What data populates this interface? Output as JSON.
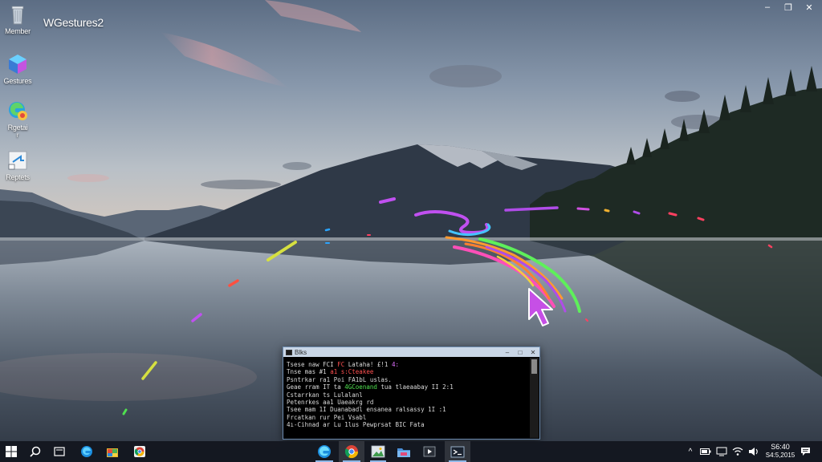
{
  "desktop": {
    "app_title": "WGestures2",
    "icons": [
      {
        "label": "Member",
        "sub": "",
        "icon": "recycle-bin-icon"
      },
      {
        "label": "Gestures",
        "sub": "",
        "icon": "cube-app-icon"
      },
      {
        "label": "Rgetai",
        "sub": "r",
        "icon": "edge-browser-icon"
      },
      {
        "label": "Reptets",
        "sub": "",
        "icon": "file-shortcut-icon"
      }
    ]
  },
  "window_controls": {
    "minimize": "–",
    "restore": "❐",
    "close": "✕"
  },
  "console": {
    "title": "Blks",
    "minimize": "–",
    "maximize": "□",
    "close": "✕",
    "lines": [
      {
        "a": "Tsese naw FCI ",
        "b": "FC",
        "c": " Lataha!  ",
        "d": "£!1  ",
        "e": "4:",
        "f": ""
      },
      {
        "a": "Tnse mas #1 ",
        "b": "",
        "c": "a1 s:Cteakee",
        "d": "",
        "e": "",
        "f": ""
      },
      {
        "a": "Psntrkar ra1 Poi FA1bL uslas.",
        "b": "",
        "c": "",
        "d": "",
        "e": "",
        "f": ""
      },
      {
        "a": "Geae rram IT ta ",
        "b": "",
        "c": "",
        "d": "4GCoenand",
        "e": " tua tlaeaabay  II 2:1",
        "f": ""
      },
      {
        "a": "Cstarrkan ts Lulalanl",
        "b": "",
        "c": "",
        "d": "",
        "e": "",
        "f": ""
      },
      {
        "a": "Petenrkes aa1 Uaeakrg  rd",
        "b": "",
        "c": "",
        "d": "",
        "e": "",
        "f": ""
      },
      {
        "a": "Tsee mam 1I Duanabadl  ",
        "b": "",
        "c": "",
        "d": "",
        "e": "ensanea ralsassy  1I :1",
        "f": ""
      },
      {
        "a": "Frcatkan rur Pei Vsabl",
        "b": "",
        "c": "",
        "d": "",
        "e": "",
        "f": ""
      },
      {
        "a": "4ı-Cihnad ar Lu 1lus Pewprsat BIC Fata",
        "b": "",
        "c": "",
        "d": "",
        "e": "",
        "f": ""
      }
    ]
  },
  "taskbar": {
    "pinned": [
      {
        "name": "start",
        "icon": "windows-start-icon"
      },
      {
        "name": "search",
        "icon": "search-icon"
      },
      {
        "name": "task-view",
        "icon": "task-view-icon"
      },
      {
        "name": "edge",
        "icon": "edge-icon"
      },
      {
        "name": "store",
        "icon": "store-icon"
      },
      {
        "name": "chrome-small",
        "icon": "chrome-icon"
      }
    ],
    "running": [
      {
        "name": "edge-running",
        "icon": "edge-icon"
      },
      {
        "name": "chrome-running",
        "icon": "chrome-icon"
      },
      {
        "name": "photos",
        "icon": "photos-icon"
      },
      {
        "name": "explorer",
        "icon": "folder-icon"
      },
      {
        "name": "media",
        "icon": "media-icon"
      },
      {
        "name": "console-running",
        "icon": "console-icon"
      }
    ],
    "tray": {
      "chevron": "^",
      "time": "S6:40",
      "date": "S4:5,2015"
    }
  },
  "colors": {
    "taskbar_bg": "#12161e",
    "console_titlebar": "#c9d6e6",
    "gesture_green": "#5ef05a",
    "gesture_pink": "#ff4fb8",
    "gesture_magenta": "#c050f0",
    "cursor_fill": "#c64fe6"
  }
}
